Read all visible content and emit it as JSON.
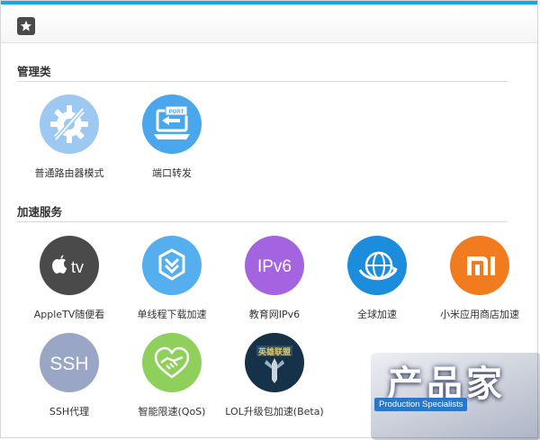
{
  "sections": [
    {
      "title": "管理类",
      "apps": [
        {
          "label": "普通路由器模式",
          "icon": "router-mode-icon",
          "color": "#9cc8f2"
        },
        {
          "label": "端口转发",
          "icon": "port-forward-icon",
          "color": "#4aa7ee"
        }
      ]
    },
    {
      "title": "加速服务",
      "apps": [
        {
          "label": "AppleTV随便看",
          "icon": "apple-tv-icon",
          "color": "#4a4a4a",
          "glyph": "tv"
        },
        {
          "label": "单线程下载加速",
          "icon": "download-accel-icon",
          "color": "#55aeee"
        },
        {
          "label": "教育网IPv6",
          "icon": "ipv6-icon",
          "color": "#a464e0",
          "glyph": "IPv6"
        },
        {
          "label": "全球加速",
          "icon": "global-accel-icon",
          "color": "#1c8ddc"
        },
        {
          "label": "小米应用商店加速",
          "icon": "mi-store-icon",
          "color": "#f07c1f",
          "glyph": "mi"
        },
        {
          "label": "SSH代理",
          "icon": "ssh-proxy-icon",
          "color": "#9aa6c6",
          "glyph": "SSH"
        },
        {
          "label": "智能限速(QoS)",
          "icon": "qos-icon",
          "color": "#8fd05c"
        },
        {
          "label": "LOL升级包加速(Beta)",
          "icon": "lol-accel-icon",
          "color": "#163248",
          "glyph": "英雄联盟"
        }
      ]
    }
  ],
  "watermark": {
    "title": "产品家",
    "subtitle": "Production Specialists"
  }
}
